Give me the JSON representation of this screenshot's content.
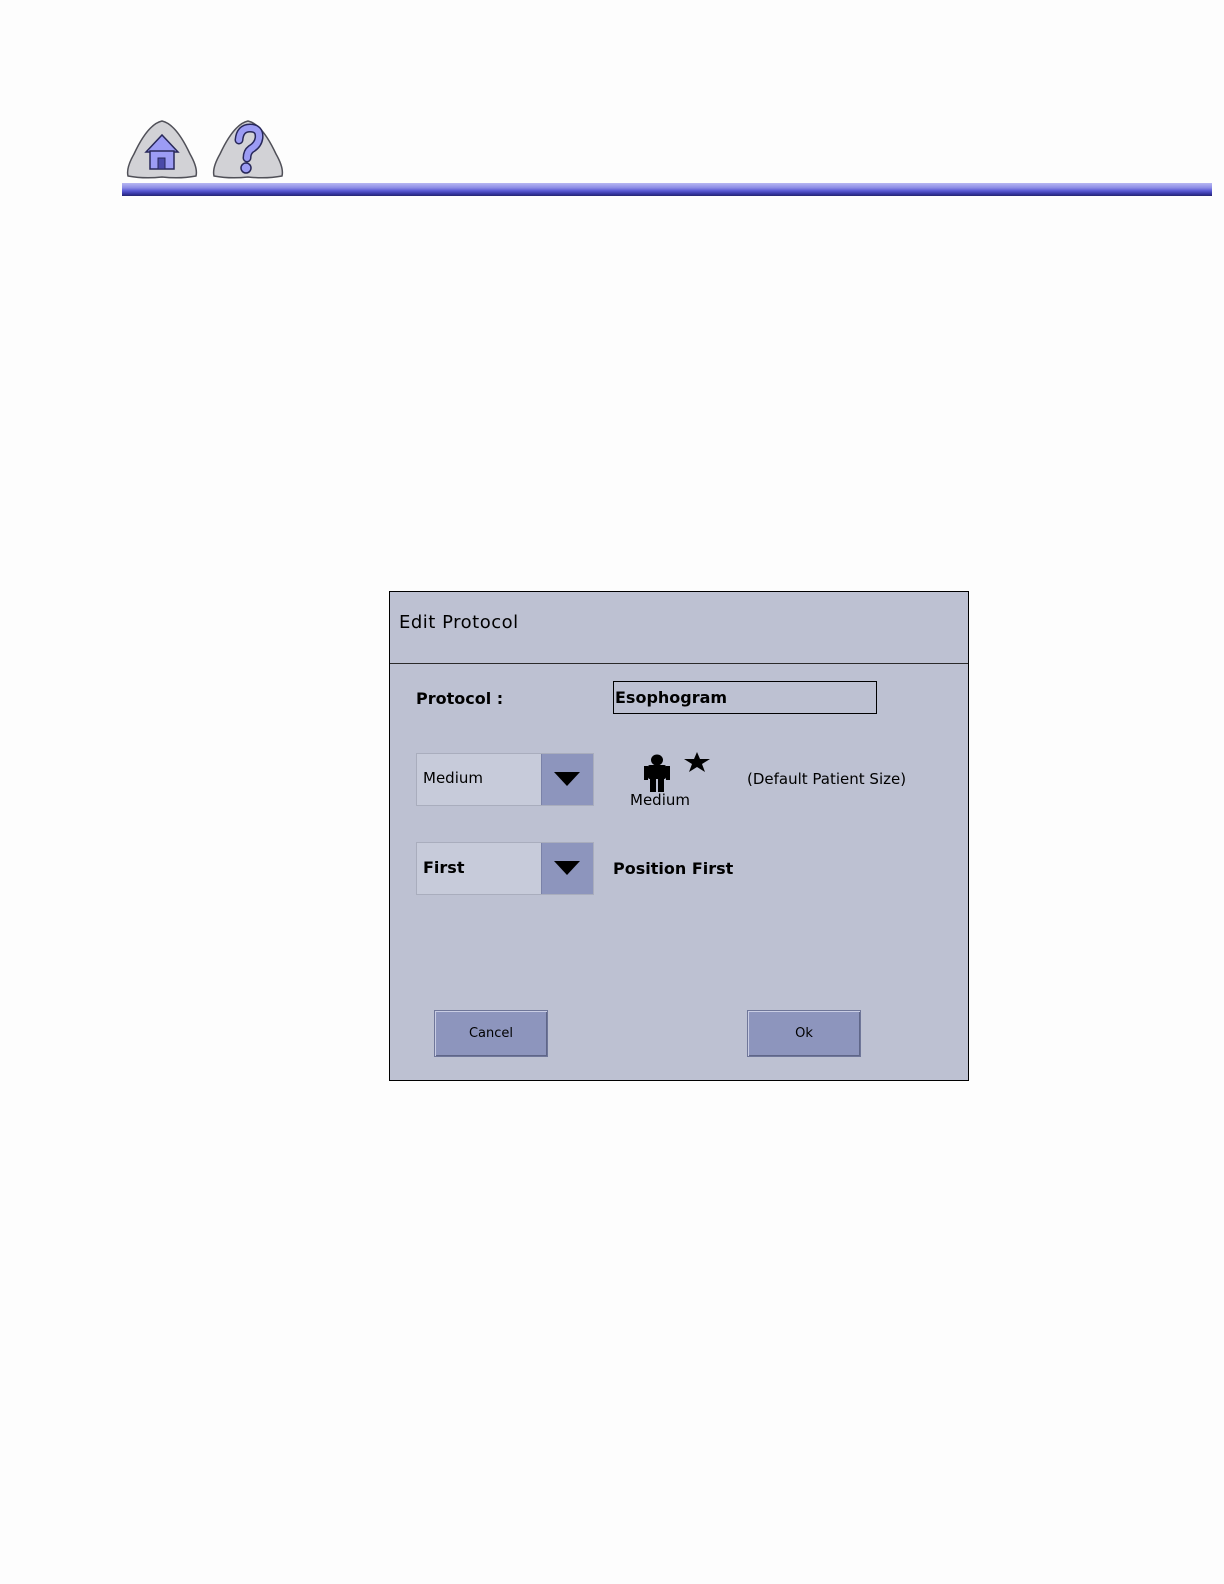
{
  "dialog": {
    "title": "Edit Protocol",
    "protocol_label": "Protocol :",
    "protocol_value": "Esophogram",
    "size_select_value": "Medium",
    "size_icon_caption": "Medium",
    "size_default_note": "(Default Patient Size)",
    "position_select_value": "First",
    "position_label": "Position First",
    "cancel_label": "Cancel",
    "ok_label": "Ok"
  },
  "icons": {
    "home": "home-icon",
    "help": "help-icon",
    "patient_figure": "patient-figure-icon",
    "default_star": "star-icon",
    "dropdown_arrow": "chevron-down-icon"
  },
  "colors": {
    "dialog_bg": "#bdc1d2",
    "button_bg": "#8d95bd",
    "header_rule": "#5a5ad4",
    "nav_icon": "#8c8cf0"
  }
}
